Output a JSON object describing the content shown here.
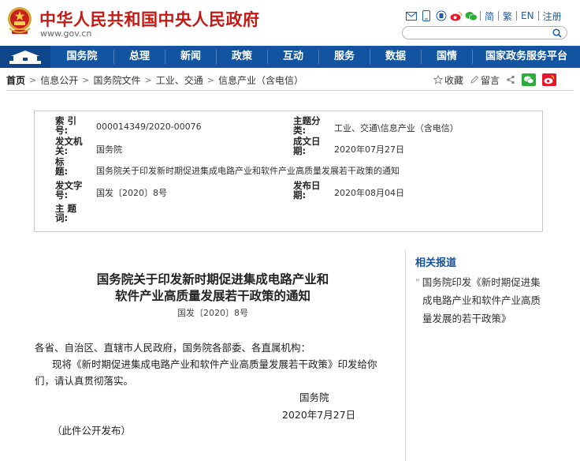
{
  "header": {
    "site_title": "中华人民共和国中央人民政府",
    "site_domain": "www.gov.cn",
    "lang_simplified": "简",
    "lang_traditional": "繁",
    "lang_english": "EN",
    "register": "注册",
    "search_placeholder": ""
  },
  "nav": {
    "items": [
      "国务院",
      "总理",
      "新闻",
      "政策",
      "互动",
      "服务",
      "数据",
      "国情",
      "国家政务服务平台"
    ]
  },
  "breadcrumb": {
    "home": "首页",
    "items": [
      "信息公开",
      "国务院文件",
      "工业、交通",
      "信息产业（含电信）"
    ]
  },
  "tools": {
    "favorite": "收藏",
    "comment": "留言"
  },
  "info": {
    "index_label": "索 引 号:",
    "index_value": "000014349/2020-00076",
    "category_label": "主题分类:",
    "category_value": "工业、交通\\信息产业（含电信）",
    "issuer_label": "发文机关:",
    "issuer_value": "国务院",
    "date_written_label": "成文日期:",
    "date_written_value": "2020年07月27日",
    "title_label": "标　　题:",
    "title_value": "国务院关于印发新时期促进集成电路产业和软件产业高质量发展若干政策的通知",
    "doc_no_label": "发文字号:",
    "doc_no_value": "国发〔2020〕8号",
    "publish_label": "发布日期:",
    "publish_value": "2020年08月04日",
    "subject_label": "主 题 词:",
    "subject_value": ""
  },
  "article": {
    "title_line1": "国务院关于印发新时期促进集成电路产业和",
    "title_line2": "软件产业高质量发展若干政策的通知",
    "doc_no": "国发〔2020〕8号",
    "salutation": "各省、自治区、直辖市人民政府，国务院各部委、各直属机构：",
    "body_line1": "现将《新时期促进集成电路产业和软件产业高质量发展若干政策》印发给你",
    "body_line2": "们，请认真贯彻落实。",
    "signature": "国务院",
    "date": "2020年7月27日",
    "note": "（此件公开发布）"
  },
  "sidebar": {
    "heading": "相关报道",
    "link_line1": "国务院印发《新时期促进集",
    "link_line2": "成电路产业和软件产业高质",
    "link_line3": "量发展的若干政策》"
  },
  "colors": {
    "brand_red": "#c41a16",
    "nav_blue": "#1354a0",
    "link_blue": "#1a5ea8"
  }
}
